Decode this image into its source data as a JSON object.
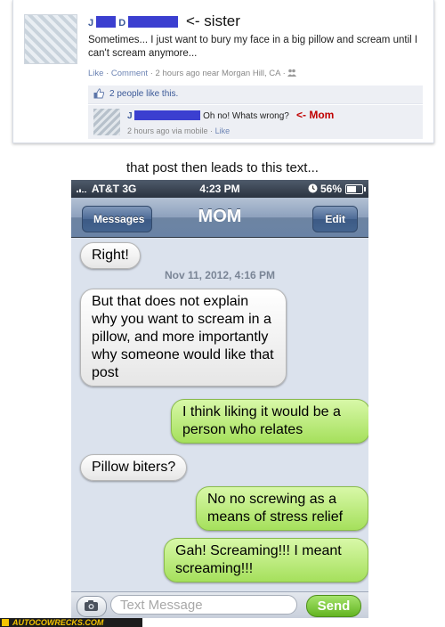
{
  "facebook": {
    "post_author_initial": "J",
    "post_author_initial_2": "D",
    "sister_note": "<- sister",
    "post_text": "Sometimes... I just want to bury my face in a big pillow and scream until I can't scream anymore...",
    "meta_like": "Like",
    "meta_sep1": " · ",
    "meta_comment": "Comment",
    "meta_rest": " · 2 hours ago near Morgan Hill, CA · ",
    "likes_text": "2 people like this.",
    "comment_author_initial": "J",
    "comment_text": "Oh no! Whats wrong?",
    "mom_note": "<- Mom",
    "comment_meta_time": "2 hours ago via mobile · ",
    "comment_meta_like": "Like"
  },
  "caption": "that post then leads to this text...",
  "phone": {
    "status": {
      "carrier": "AT&T 3G",
      "time": "4:23 PM",
      "battery": "56%"
    },
    "nav": {
      "back_label": "Messages",
      "title": "MOM",
      "edit_label": "Edit"
    },
    "timestamp": "Nov 11, 2012, 4:16 PM",
    "messages": [
      {
        "from": "them",
        "text": "Right!"
      },
      {
        "from": "them",
        "text": "But that does not explain why you want to scream in a pillow, and more importantly why someone would like that post"
      },
      {
        "from": "me",
        "text": "I think liking it would be a person who relates"
      },
      {
        "from": "them",
        "text": "Pillow biters?"
      },
      {
        "from": "me",
        "text": "No no screwing as a means of stress relief"
      },
      {
        "from": "me",
        "text": "Gah! Screaming!!! I meant screaming!!!"
      }
    ],
    "input": {
      "placeholder": "Text Message",
      "send_label": "Send"
    }
  },
  "watermark": "AUTOCOWRECKS.COM",
  "colors": {
    "redaction": "#3b3fd0",
    "mom_note": "#c00000",
    "bubble_out": "#a5e05c",
    "bubble_in": "#ffffff"
  },
  "icons": [
    "thumbs-up-icon",
    "globe-icon",
    "camera-icon",
    "battery-icon",
    "signal-icon"
  ]
}
